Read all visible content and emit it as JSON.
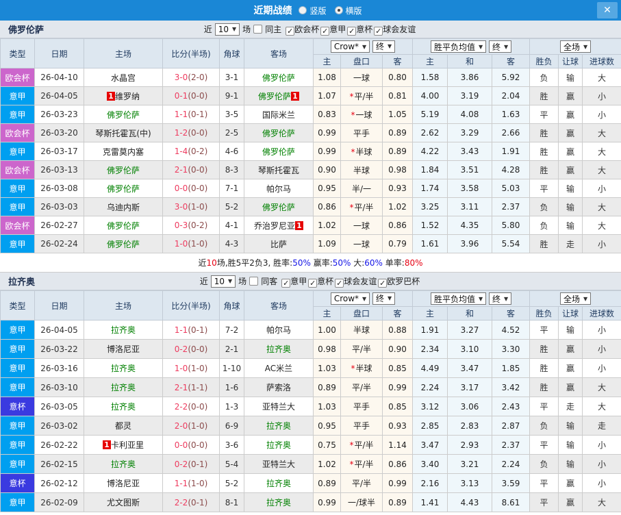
{
  "titlebar": {
    "title": "近期战绩",
    "close_glyph": "✕",
    "layout_options": [
      {
        "label": "竖版",
        "selected": false
      },
      {
        "label": "横版",
        "selected": true
      }
    ]
  },
  "palette": {
    "titlebar_bg": "#1a87d6",
    "close_bg": "#56a8e2",
    "section_header_bg": "#e2e7ed",
    "table_header_bg": "#dde7f0",
    "crow_col_bg": "#fdf8ef",
    "mean_col_bg": "#eff7fb",
    "team_green": "#008000",
    "score_red": "#ee3b5f",
    "half_red": "#8a4a4a",
    "red": "#e60012",
    "green": "#007a00",
    "blue": "#1414e6"
  },
  "badge_colors": {
    "欧会杯": "#cc66cc",
    "意甲": "#009ff0",
    "意杯": "#3a3ae0"
  },
  "columns": {
    "type": "类型",
    "date": "日期",
    "home": "主场",
    "score_half": "比分(半场)",
    "corners": "角球",
    "away": "客场",
    "odds_home": "主",
    "handicap": "盘口",
    "odds_away": "客",
    "mean_home": "主",
    "mean_draw": "和",
    "mean_away": "客",
    "result": "胜负",
    "handicap_result": "让球",
    "goals": "进球数"
  },
  "dropdowns": {
    "crow": "Crow*",
    "final": "终",
    "mean": "胜平负均值",
    "full_game": "全场"
  },
  "sections": [
    {
      "team": "佛罗伦萨",
      "near_label": "近",
      "games_count": "10",
      "games_label": "场",
      "same_label": "同主",
      "same_checked": false,
      "filters": [
        "欧会杯",
        "意甲",
        "意杯",
        "球会友谊"
      ],
      "rows": [
        {
          "league": "欧会杯",
          "date": "26-04-10",
          "home": {
            "name": "水晶宫"
          },
          "score": "3-0",
          "half": "(2-0)",
          "corners": "3-1",
          "away": {
            "name": "佛罗伦萨",
            "green": true
          },
          "home_odds": "1.08",
          "handicap": "一球",
          "star": false,
          "away_odds": "0.80",
          "mean": [
            "1.58",
            "3.86",
            "5.92"
          ],
          "result": {
            "text": "负",
            "color": "green"
          },
          "handicap_result": {
            "text": "输",
            "color": "green"
          },
          "goals": {
            "text": "大",
            "color": "red"
          }
        },
        {
          "league": "意甲",
          "date": "26-04-05",
          "home": {
            "name": "维罗纳",
            "badge_before": "1"
          },
          "score": "0-1",
          "half": "(0-0)",
          "corners": "9-1",
          "away": {
            "name": "佛罗伦萨",
            "green": true,
            "badge_after": "1"
          },
          "home_odds": "1.07",
          "handicap": "平/半",
          "star": true,
          "away_odds": "0.81",
          "mean": [
            "4.00",
            "3.19",
            "2.04"
          ],
          "result": {
            "text": "胜",
            "color": "red"
          },
          "handicap_result": {
            "text": "赢",
            "color": "red"
          },
          "goals": {
            "text": "小",
            "color": "green"
          }
        },
        {
          "league": "意甲",
          "date": "26-03-23",
          "home": {
            "name": "佛罗伦萨",
            "green": true
          },
          "score": "1-1",
          "half": "(0-1)",
          "corners": "3-5",
          "away": {
            "name": "国际米兰"
          },
          "home_odds": "0.83",
          "handicap": "一球",
          "star": true,
          "away_odds": "1.05",
          "mean": [
            "5.19",
            "4.08",
            "1.63"
          ],
          "result": {
            "text": "平",
            "color": "blue"
          },
          "handicap_result": {
            "text": "赢",
            "color": "red"
          },
          "goals": {
            "text": "小",
            "color": "green"
          }
        },
        {
          "league": "欧会杯",
          "date": "26-03-20",
          "home": {
            "name": "琴斯托霍瓦(中)"
          },
          "score": "1-2",
          "half": "(0-0)",
          "corners": "2-5",
          "away": {
            "name": "佛罗伦萨",
            "green": true
          },
          "home_odds": "0.99",
          "handicap": "平手",
          "star": false,
          "away_odds": "0.89",
          "mean": [
            "2.62",
            "3.29",
            "2.66"
          ],
          "result": {
            "text": "胜",
            "color": "red"
          },
          "handicap_result": {
            "text": "赢",
            "color": "red"
          },
          "goals": {
            "text": "大",
            "color": "red"
          }
        },
        {
          "league": "意甲",
          "date": "26-03-17",
          "home": {
            "name": "克雷莫内塞"
          },
          "score": "1-4",
          "half": "(0-2)",
          "corners": "4-6",
          "away": {
            "name": "佛罗伦萨",
            "green": true
          },
          "home_odds": "0.99",
          "handicap": "半球",
          "star": true,
          "away_odds": "0.89",
          "mean": [
            "4.22",
            "3.43",
            "1.91"
          ],
          "result": {
            "text": "胜",
            "color": "red"
          },
          "handicap_result": {
            "text": "赢",
            "color": "red"
          },
          "goals": {
            "text": "大",
            "color": "red"
          }
        },
        {
          "league": "欧会杯",
          "date": "26-03-13",
          "home": {
            "name": "佛罗伦萨",
            "green": true
          },
          "score": "2-1",
          "half": "(0-0)",
          "corners": "8-3",
          "away": {
            "name": "琴斯托霍瓦"
          },
          "home_odds": "0.90",
          "handicap": "半球",
          "star": false,
          "away_odds": "0.98",
          "mean": [
            "1.84",
            "3.51",
            "4.28"
          ],
          "result": {
            "text": "胜",
            "color": "red"
          },
          "handicap_result": {
            "text": "赢",
            "color": "red"
          },
          "goals": {
            "text": "大",
            "color": "red"
          }
        },
        {
          "league": "意甲",
          "date": "26-03-08",
          "home": {
            "name": "佛罗伦萨",
            "green": true
          },
          "score": "0-0",
          "half": "(0-0)",
          "corners": "7-1",
          "away": {
            "name": "帕尔马"
          },
          "home_odds": "0.95",
          "handicap": "半/一",
          "star": false,
          "away_odds": "0.93",
          "mean": [
            "1.74",
            "3.58",
            "5.03"
          ],
          "result": {
            "text": "平",
            "color": "blue"
          },
          "handicap_result": {
            "text": "输",
            "color": "green"
          },
          "goals": {
            "text": "小",
            "color": "green"
          }
        },
        {
          "league": "意甲",
          "date": "26-03-03",
          "home": {
            "name": "乌迪内斯"
          },
          "score": "3-0",
          "half": "(1-0)",
          "corners": "5-2",
          "away": {
            "name": "佛罗伦萨",
            "green": true
          },
          "home_odds": "0.86",
          "handicap": "平/半",
          "star": true,
          "away_odds": "1.02",
          "mean": [
            "3.25",
            "3.11",
            "2.37"
          ],
          "result": {
            "text": "负",
            "color": "green"
          },
          "handicap_result": {
            "text": "输",
            "color": "green"
          },
          "goals": {
            "text": "大",
            "color": "red"
          }
        },
        {
          "league": "欧会杯",
          "date": "26-02-27",
          "home": {
            "name": "佛罗伦萨",
            "green": true
          },
          "score": "0-3",
          "half": "(0-2)",
          "corners": "4-1",
          "away": {
            "name": "乔治罗尼亚",
            "badge_after": "1"
          },
          "home_odds": "1.02",
          "handicap": "一球",
          "star": false,
          "away_odds": "0.86",
          "mean": [
            "1.52",
            "4.35",
            "5.80"
          ],
          "result": {
            "text": "负",
            "color": "green"
          },
          "handicap_result": {
            "text": "输",
            "color": "green"
          },
          "goals": {
            "text": "大",
            "color": "red"
          }
        },
        {
          "league": "意甲",
          "date": "26-02-24",
          "home": {
            "name": "佛罗伦萨",
            "green": true
          },
          "score": "1-0",
          "half": "(1-0)",
          "corners": "4-3",
          "away": {
            "name": "比萨"
          },
          "home_odds": "1.09",
          "handicap": "一球",
          "star": false,
          "away_odds": "0.79",
          "mean": [
            "1.61",
            "3.96",
            "5.54"
          ],
          "result": {
            "text": "胜",
            "color": "red"
          },
          "handicap_result": {
            "text": "走",
            "color": "blue"
          },
          "goals": {
            "text": "小",
            "color": "green"
          }
        }
      ],
      "summary_segments": [
        {
          "text": "近",
          "color": "base"
        },
        {
          "text": "10",
          "color": "red"
        },
        {
          "text": "场,胜5平2负3, 胜率:",
          "color": "base"
        },
        {
          "text": "50%",
          "color": "blue"
        },
        {
          "text": " 赢率:",
          "color": "base"
        },
        {
          "text": "50%",
          "color": "blue"
        },
        {
          "text": " 大:",
          "color": "base"
        },
        {
          "text": "60%",
          "color": "blue"
        },
        {
          "text": " 单率:",
          "color": "base"
        },
        {
          "text": "80%",
          "color": "red"
        }
      ]
    },
    {
      "team": "拉齐奥",
      "near_label": "近",
      "games_count": "10",
      "games_label": "场",
      "same_label": "同客",
      "same_checked": false,
      "filters": [
        "意甲",
        "意杯",
        "球会友谊",
        "欧罗巴杯"
      ],
      "rows": [
        {
          "league": "意甲",
          "date": "26-04-05",
          "home": {
            "name": "拉齐奥",
            "green": true
          },
          "score": "1-1",
          "half": "(0-1)",
          "corners": "7-2",
          "away": {
            "name": "帕尔马"
          },
          "home_odds": "1.00",
          "handicap": "半球",
          "star": false,
          "away_odds": "0.88",
          "mean": [
            "1.91",
            "3.27",
            "4.52"
          ],
          "result": {
            "text": "平",
            "color": "blue"
          },
          "handicap_result": {
            "text": "输",
            "color": "green"
          },
          "goals": {
            "text": "小",
            "color": "green"
          }
        },
        {
          "league": "意甲",
          "date": "26-03-22",
          "home": {
            "name": "博洛尼亚"
          },
          "score": "0-2",
          "half": "(0-0)",
          "corners": "2-1",
          "away": {
            "name": "拉齐奥",
            "green": true
          },
          "home_odds": "0.98",
          "handicap": "平/半",
          "star": false,
          "away_odds": "0.90",
          "mean": [
            "2.34",
            "3.10",
            "3.30"
          ],
          "result": {
            "text": "胜",
            "color": "red"
          },
          "handicap_result": {
            "text": "赢",
            "color": "red"
          },
          "goals": {
            "text": "小",
            "color": "green"
          }
        },
        {
          "league": "意甲",
          "date": "26-03-16",
          "home": {
            "name": "拉齐奥",
            "green": true
          },
          "score": "1-0",
          "half": "(1-0)",
          "corners": "1-10",
          "away": {
            "name": "AC米兰"
          },
          "home_odds": "1.03",
          "handicap": "半球",
          "star": true,
          "away_odds": "0.85",
          "mean": [
            "4.49",
            "3.47",
            "1.85"
          ],
          "result": {
            "text": "胜",
            "color": "red"
          },
          "handicap_result": {
            "text": "赢",
            "color": "red"
          },
          "goals": {
            "text": "小",
            "color": "green"
          }
        },
        {
          "league": "意甲",
          "date": "26-03-10",
          "home": {
            "name": "拉齐奥",
            "green": true
          },
          "score": "2-1",
          "half": "(1-1)",
          "corners": "1-6",
          "away": {
            "name": "萨索洛"
          },
          "home_odds": "0.89",
          "handicap": "平/半",
          "star": false,
          "away_odds": "0.99",
          "mean": [
            "2.24",
            "3.17",
            "3.42"
          ],
          "result": {
            "text": "胜",
            "color": "red"
          },
          "handicap_result": {
            "text": "赢",
            "color": "red"
          },
          "goals": {
            "text": "大",
            "color": "red"
          }
        },
        {
          "league": "意杯",
          "date": "26-03-05",
          "home": {
            "name": "拉齐奥",
            "green": true
          },
          "score": "2-2",
          "half": "(0-0)",
          "corners": "1-3",
          "away": {
            "name": "亚特兰大"
          },
          "home_odds": "1.03",
          "handicap": "平手",
          "star": false,
          "away_odds": "0.85",
          "mean": [
            "3.12",
            "3.06",
            "2.43"
          ],
          "result": {
            "text": "平",
            "color": "blue"
          },
          "handicap_result": {
            "text": "走",
            "color": "blue"
          },
          "goals": {
            "text": "大",
            "color": "red"
          }
        },
        {
          "league": "意甲",
          "date": "26-03-02",
          "home": {
            "name": "都灵"
          },
          "score": "2-0",
          "half": "(1-0)",
          "corners": "6-9",
          "away": {
            "name": "拉齐奥",
            "green": true
          },
          "home_odds": "0.95",
          "handicap": "平手",
          "star": false,
          "away_odds": "0.93",
          "mean": [
            "2.85",
            "2.83",
            "2.87"
          ],
          "result": {
            "text": "负",
            "color": "green"
          },
          "handicap_result": {
            "text": "输",
            "color": "green"
          },
          "goals": {
            "text": "走",
            "color": "blue"
          }
        },
        {
          "league": "意甲",
          "date": "26-02-22",
          "home": {
            "name": "卡利亚里",
            "badge_before": "1"
          },
          "score": "0-0",
          "half": "(0-0)",
          "corners": "3-6",
          "away": {
            "name": "拉齐奥",
            "green": true
          },
          "home_odds": "0.75",
          "handicap": "平/半",
          "star": true,
          "away_odds": "1.14",
          "mean": [
            "3.47",
            "2.93",
            "2.37"
          ],
          "result": {
            "text": "平",
            "color": "blue"
          },
          "handicap_result": {
            "text": "输",
            "color": "green"
          },
          "goals": {
            "text": "小",
            "color": "green"
          }
        },
        {
          "league": "意甲",
          "date": "26-02-15",
          "home": {
            "name": "拉齐奥",
            "green": true
          },
          "score": "0-2",
          "half": "(0-1)",
          "corners": "5-4",
          "away": {
            "name": "亚特兰大"
          },
          "home_odds": "1.02",
          "handicap": "平/半",
          "star": true,
          "away_odds": "0.86",
          "mean": [
            "3.40",
            "3.21",
            "2.24"
          ],
          "result": {
            "text": "负",
            "color": "green"
          },
          "handicap_result": {
            "text": "输",
            "color": "green"
          },
          "goals": {
            "text": "小",
            "color": "green"
          }
        },
        {
          "league": "意杯",
          "date": "26-02-12",
          "home": {
            "name": "博洛尼亚"
          },
          "score": "1-1",
          "half": "(1-0)",
          "corners": "5-2",
          "away": {
            "name": "拉齐奥",
            "green": true
          },
          "home_odds": "0.89",
          "handicap": "平/半",
          "star": false,
          "away_odds": "0.99",
          "mean": [
            "2.16",
            "3.13",
            "3.59"
          ],
          "result": {
            "text": "平",
            "color": "blue"
          },
          "handicap_result": {
            "text": "赢",
            "color": "red"
          },
          "goals": {
            "text": "小",
            "color": "green"
          }
        },
        {
          "league": "意甲",
          "date": "26-02-09",
          "home": {
            "name": "尤文图斯"
          },
          "score": "2-2",
          "half": "(0-1)",
          "corners": "8-1",
          "away": {
            "name": "拉齐奥",
            "green": true
          },
          "home_odds": "0.99",
          "handicap": "一/球半",
          "star": false,
          "away_odds": "0.89",
          "mean": [
            "1.41",
            "4.43",
            "8.61"
          ],
          "result": {
            "text": "平",
            "color": "blue"
          },
          "handicap_result": {
            "text": "赢",
            "color": "red"
          },
          "goals": {
            "text": "大",
            "color": "red"
          }
        }
      ]
    }
  ]
}
